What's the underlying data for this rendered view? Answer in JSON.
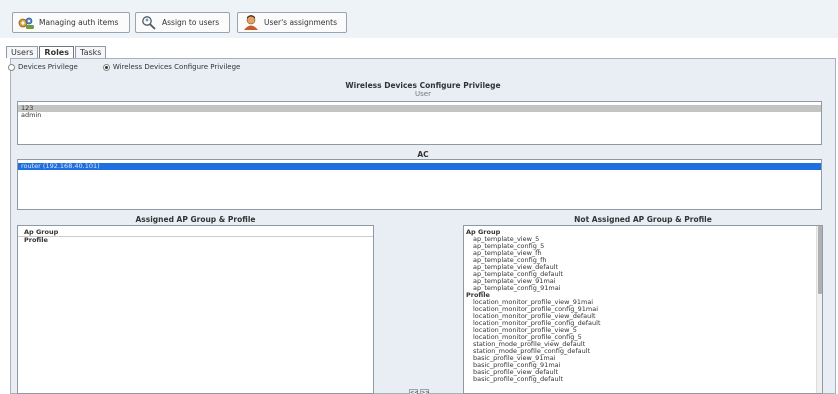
{
  "toolbar": {
    "managing_label": "Managing auth items",
    "assign_label": "Assign to users",
    "assignments_label": "User's assignments"
  },
  "tabs": [
    "Users",
    "Roles",
    "Tasks"
  ],
  "radios": {
    "devices_privilege": "Devices Privilege",
    "wireless_privilege": "Wireless Devices Configure Privilege"
  },
  "panel": {
    "title": "Wireless Devices Configure Privilege",
    "user_label": "User",
    "users": [
      "123",
      "admin"
    ],
    "ac_label": "AC",
    "ac_items": [
      "router (192.168.40.101)"
    ]
  },
  "assigned": {
    "title": "Assigned AP Group & Profile",
    "group_head": "Ap Group",
    "profile_head": "Profile"
  },
  "not_assigned": {
    "title": "Not Assigned AP Group & Profile",
    "group_head": "Ap Group",
    "groups": [
      "ap_template_view_5",
      "ap_template_config_5",
      "ap_template_view_fh",
      "ap_template_config_fh",
      "ap_template_view_default",
      "ap_template_config_default",
      "ap_template_view_91mai",
      "ap_template_config_91mai"
    ],
    "profile_head": "Profile",
    "profiles": [
      "location_monitor_profile_view_91mai",
      "location_monitor_profile_config_91mai",
      "location_monitor_profile_view_default",
      "location_monitor_profile_config_default",
      "location_monitor_profile_view_5",
      "location_monitor_profile_config_5",
      "station_mode_profile_view_default",
      "station_mode_profile_config_default",
      "basic_profile_view_91mai",
      "basic_profile_config_91mai",
      "basic_profile_view_default",
      "basic_profile_config_default"
    ]
  },
  "move": {
    "left_label": "<<",
    "right_label": ">>"
  },
  "colors": {
    "toolbar_bg": "#eef3f8",
    "panel_bg": "#e8eef4",
    "selection_blue": "#1e6fe0",
    "selection_gray": "#c4c4c4"
  },
  "icons": {
    "managing": "gear-people-icon",
    "assign": "magnifier-user-icon",
    "assignments": "user-avatar-icon"
  }
}
